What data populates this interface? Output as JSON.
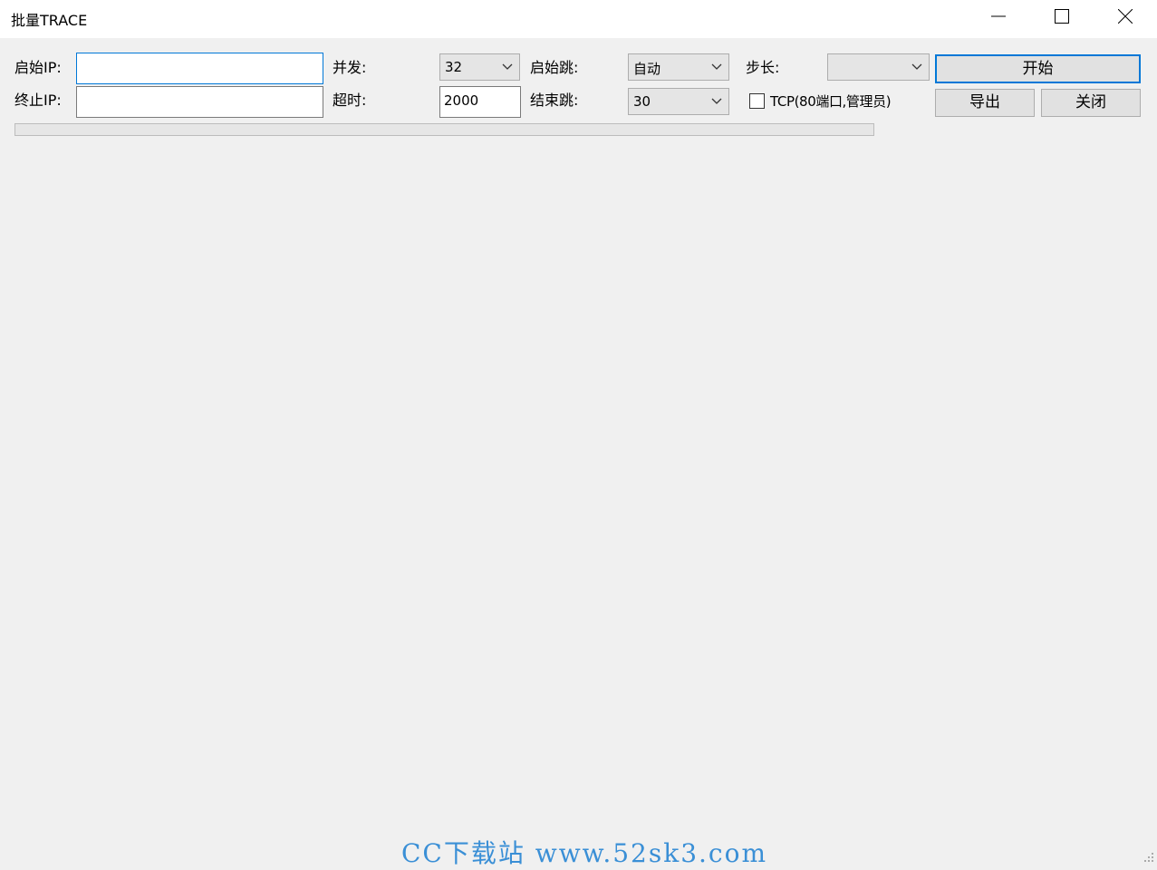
{
  "window": {
    "title": "批量TRACE"
  },
  "form": {
    "start_ip_label": "启始IP:",
    "start_ip_value": "",
    "end_ip_label": "终止IP:",
    "end_ip_value": "",
    "concurrency_label": "并发:",
    "concurrency_value": "32",
    "timeout_label": "超时:",
    "timeout_value": "2000",
    "start_hop_label": "启始跳:",
    "start_hop_value": "自动",
    "end_hop_label": "结束跳:",
    "end_hop_value": "30",
    "step_label": "步长:",
    "step_value": "",
    "tcp_label": "TCP(80端口,管理员)",
    "tcp_checked": false
  },
  "buttons": {
    "start": "开始",
    "export": "导出",
    "close": "关闭"
  },
  "progress": {
    "value_percent": 0
  },
  "watermark": {
    "text": "CC下载站 www.52sk3.com"
  },
  "icons": {
    "minimize": "minimize-icon",
    "maximize": "maximize-icon",
    "close": "close-icon",
    "dropdown": "chevron-down-icon",
    "resize": "resize-grip-icon"
  }
}
